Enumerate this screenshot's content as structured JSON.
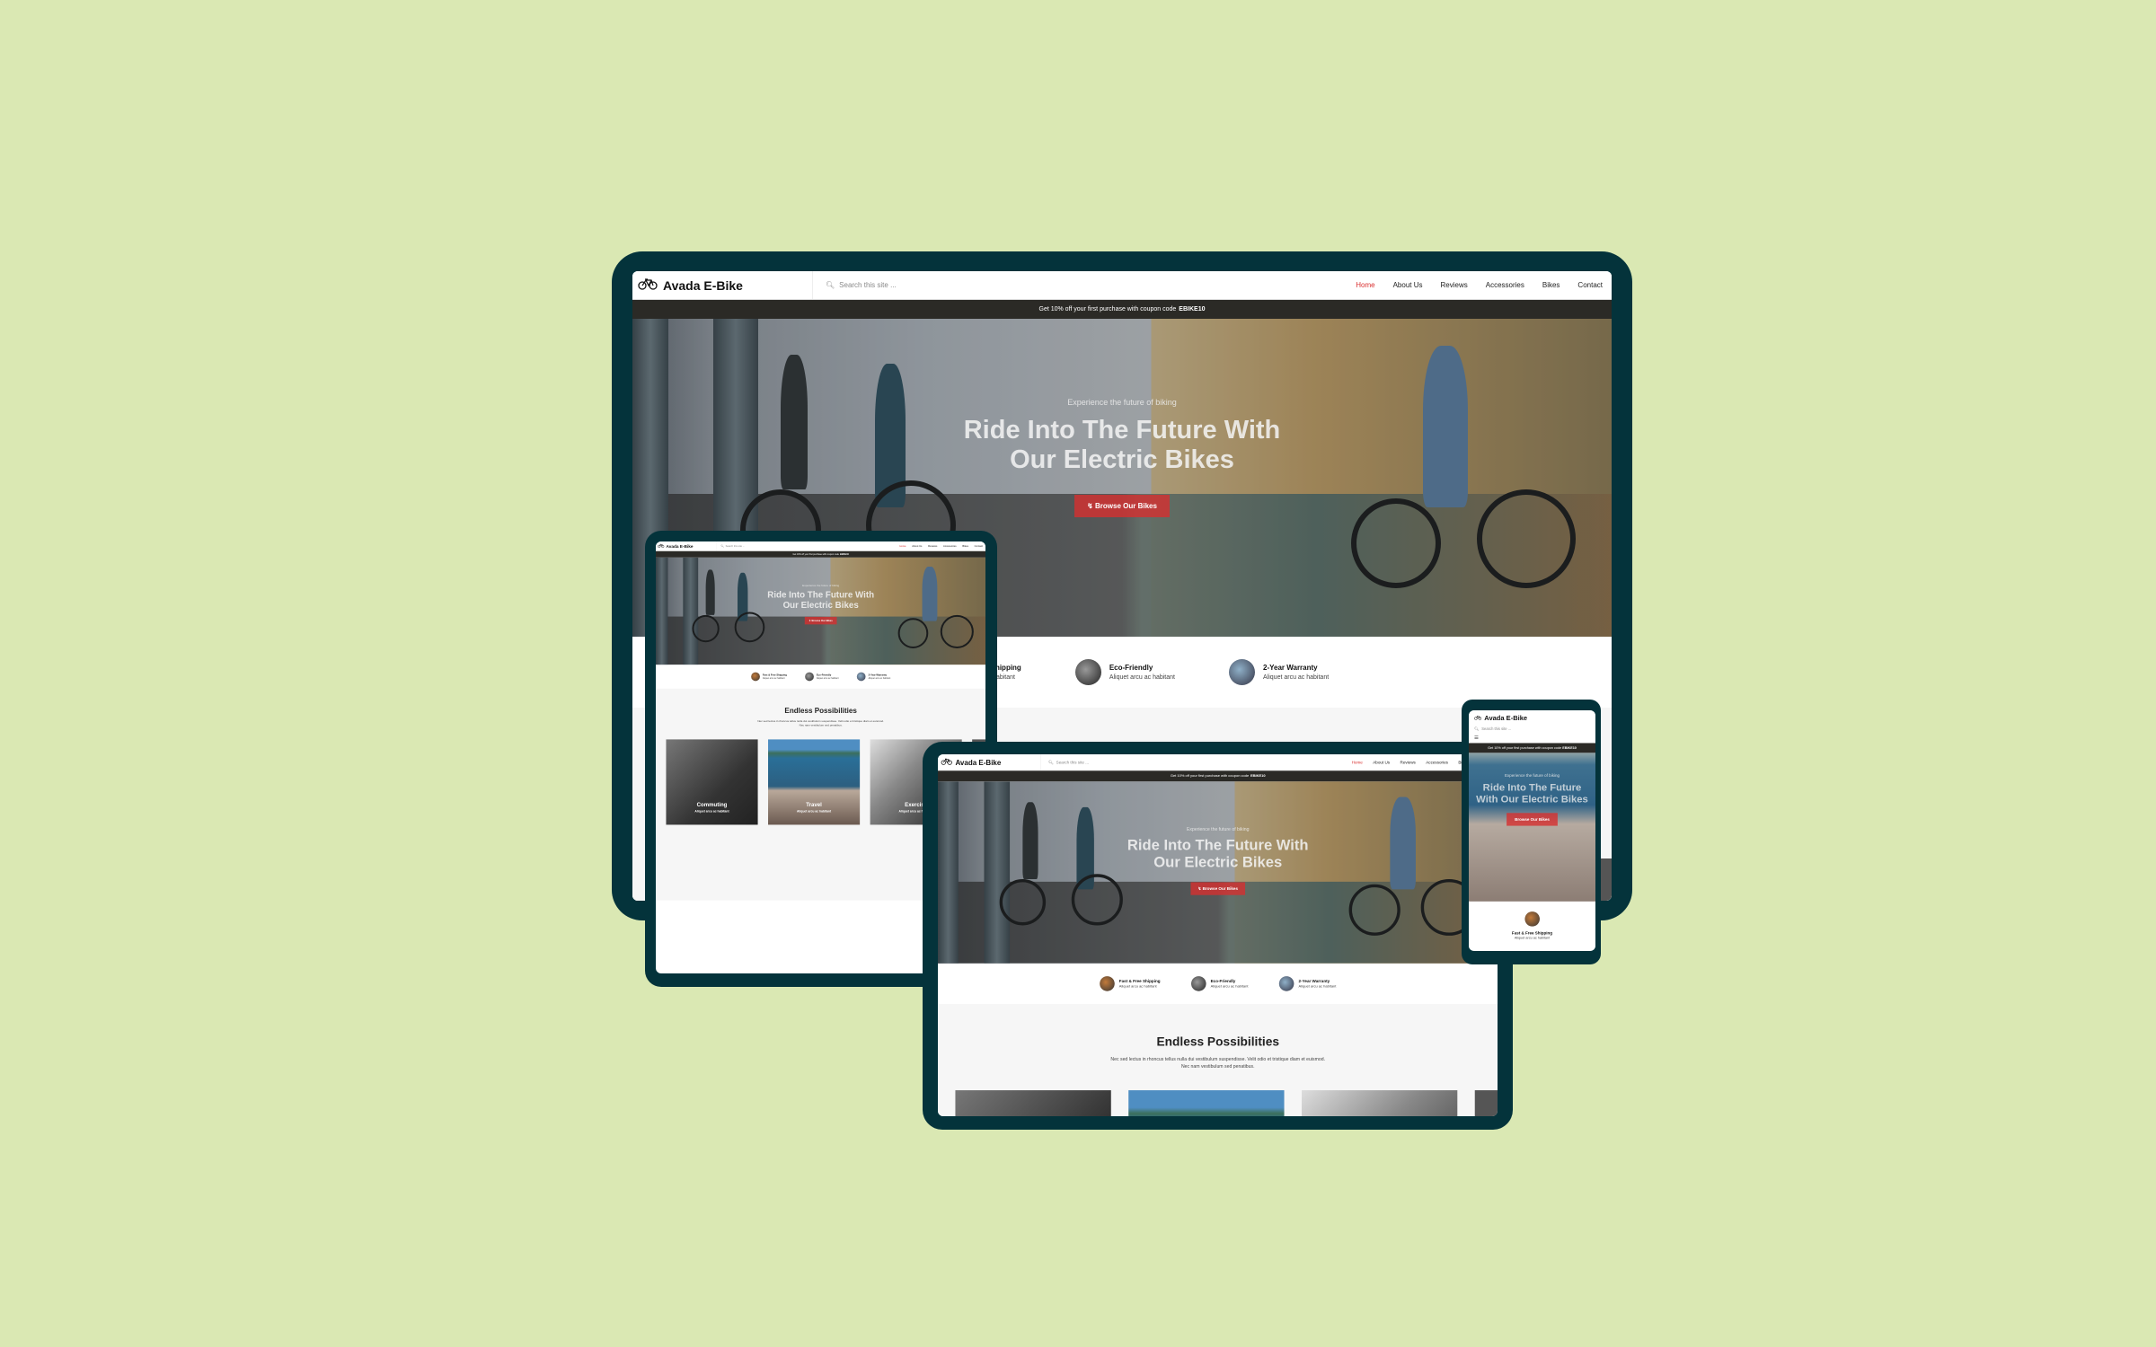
{
  "colors": {
    "background": "#dae8b3",
    "device_frame": "#04333b",
    "accent": "#d92e2e",
    "promo_bar": "#2b2a26"
  },
  "site": {
    "brand": "Avada E-Bike",
    "logo_icon": "bicycle-icon",
    "search_placeholder": "Search this site ...",
    "nav": [
      "Home",
      "About Us",
      "Reviews",
      "Accessories",
      "Bikes",
      "Contact"
    ],
    "promo_text": "Get 10% off your first purchase with coupon code",
    "promo_code": "EBIKE10",
    "hero": {
      "eyebrow": "Experience the future of biking",
      "title": "Ride Into The Future With Our Electric Bikes",
      "button": "Browse Our Bikes"
    },
    "features": [
      {
        "title": "Fast & Free Shipping",
        "text": "Aliquet arcu ac habitant"
      },
      {
        "title": "Eco-Friendly",
        "text": "Aliquet arcu ac habitant"
      },
      {
        "title": "2-Year Warranty",
        "text": "Aliquet arcu ac habitant"
      }
    ],
    "endless": {
      "title": "Endless Possibilities",
      "text": "Nec sed lectus in rhoncus tellus nulla dui vestibulum suspendisse. Velit odio et tristique diam et euismod. Nec nam vestibulum sed penatibus.",
      "cards": [
        {
          "title": "Commuting",
          "text": "Aliquet arcu ac habitant"
        },
        {
          "title": "Travel",
          "text": "Aliquet arcu ac habitant"
        },
        {
          "title": "Exercise",
          "text": "Aliquet arcu ac habitant"
        }
      ]
    }
  }
}
